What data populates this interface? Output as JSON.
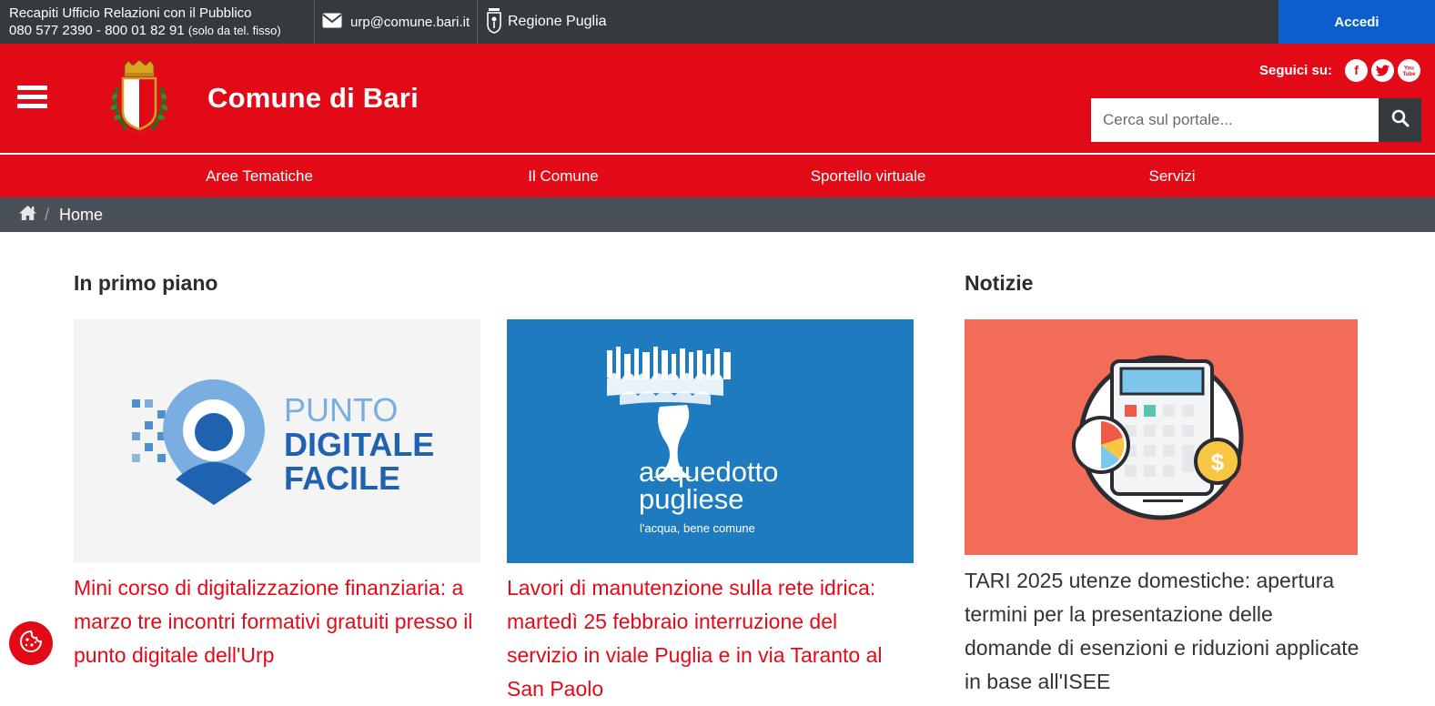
{
  "topbar": {
    "contacts_title": "Recapiti Ufficio Relazioni con il Pubblico",
    "contacts_phones": "080 577 2390 - 800 01 82 91",
    "contacts_note": "(solo da tel. fisso)",
    "email": "urp@comune.bari.it",
    "regione": "Regione Puglia",
    "login": "Accedi"
  },
  "header": {
    "site_title": "Comune di Bari",
    "follow_label": "Seguici su:",
    "search_placeholder": "Cerca sul portale..."
  },
  "nav": {
    "items": [
      {
        "label": "Aree Tematiche"
      },
      {
        "label": "Il Comune"
      },
      {
        "label": "Sportello virtuale"
      },
      {
        "label": "Servizi"
      }
    ]
  },
  "breadcrumb": {
    "current": "Home"
  },
  "primo_piano": {
    "heading": "In primo piano",
    "cards": [
      {
        "title": "Mini corso di digitalizzazione finanziaria: a marzo tre incontri formativi gratuiti presso il punto digitale dell'Urp",
        "logo_top": "PUNTO",
        "logo_mid": "DIGITALE",
        "logo_bot": "FACILE"
      },
      {
        "title": "Lavori di manutenzione sulla rete idrica: martedì 25 febbraio interruzione del servizio in viale Puglia e in via Taranto al San Paolo",
        "logo_line1": "acquedotto",
        "logo_line2": "pugliese",
        "logo_tagline": "l'acqua, bene comune"
      }
    ]
  },
  "notizie": {
    "heading": "Notizie",
    "items": [
      {
        "title": "TARI 2025 utenze domestiche: apertura termini per la presentazione delle domande di esenzioni e riduzioni applicate in base all'ISEE"
      }
    ]
  },
  "colors": {
    "brand_red": "#e30a17",
    "topbar": "#353a3e",
    "login_blue": "#0c5ecc",
    "breadcrumb": "#4a5057"
  }
}
